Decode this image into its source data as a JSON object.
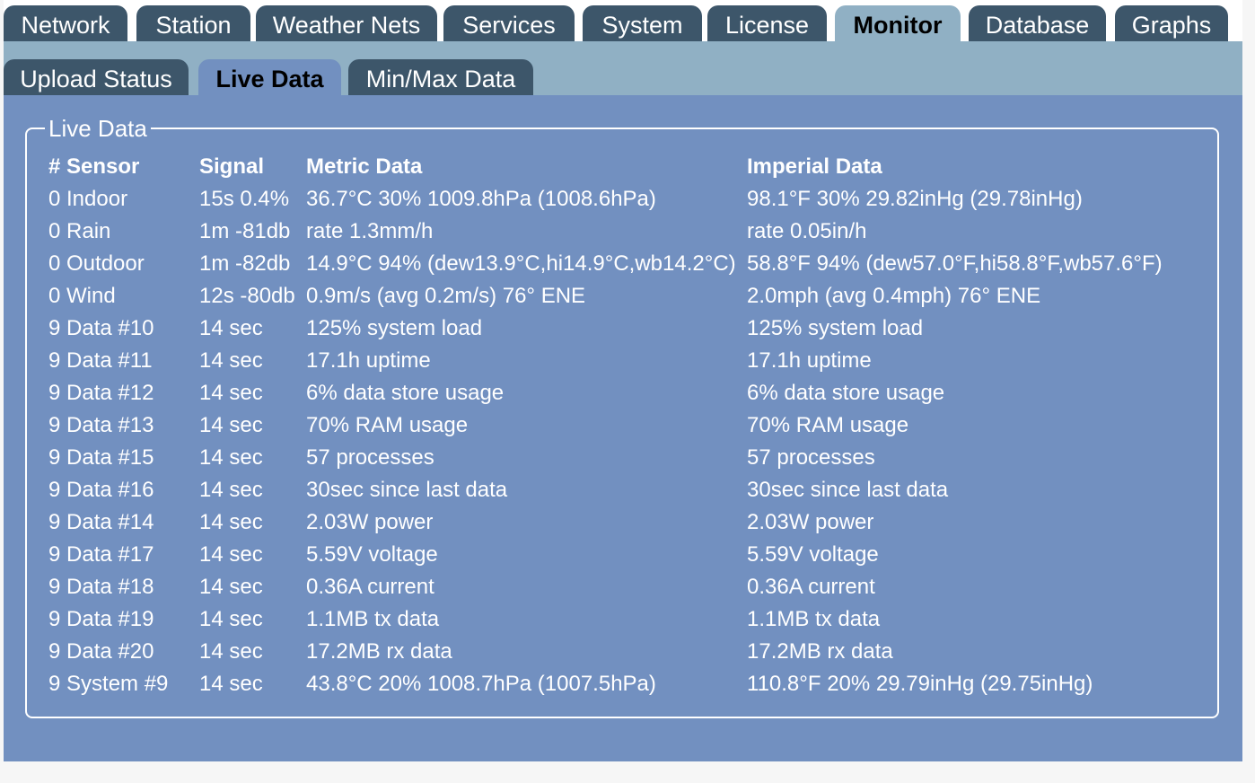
{
  "top_tabs": [
    "Network",
    "Station",
    "Weather Nets",
    "Services",
    "System",
    "License",
    "Monitor",
    "Database",
    "Graphs"
  ],
  "sub_tabs": [
    "Upload Status",
    "Live Data",
    "Min/Max Data"
  ],
  "live_data": {
    "legend": "Live Data",
    "headers": [
      "# Sensor",
      "Signal",
      "Metric Data",
      "Imperial Data"
    ],
    "rows": [
      [
        "0 Indoor",
        "15s 0.4%",
        "36.7°C 30% 1009.8hPa (1008.6hPa)",
        "98.1°F 30% 29.82inHg (29.78inHg)"
      ],
      [
        "0 Rain",
        "1m -81db",
        "rate 1.3mm/h",
        "rate 0.05in/h"
      ],
      [
        "0 Outdoor",
        "1m -82db",
        "14.9°C 94% (dew13.9°C,hi14.9°C,wb14.2°C)",
        "58.8°F 94% (dew57.0°F,hi58.8°F,wb57.6°F)"
      ],
      [
        "0 Wind",
        "12s -80db",
        "0.9m/s (avg 0.2m/s) 76° ENE",
        "2.0mph (avg 0.4mph) 76° ENE"
      ],
      [
        "9 Data #10",
        "14 sec",
        "125% system load",
        "125% system load"
      ],
      [
        "9 Data #11",
        "14 sec",
        "17.1h uptime",
        "17.1h uptime"
      ],
      [
        "9 Data #12",
        "14 sec",
        "6% data store usage",
        "6% data store usage"
      ],
      [
        "9 Data #13",
        "14 sec",
        "70% RAM usage",
        "70% RAM usage"
      ],
      [
        "9 Data #15",
        "14 sec",
        "57 processes",
        "57 processes"
      ],
      [
        "9 Data #16",
        "14 sec",
        "30sec since last data",
        "30sec since last data"
      ],
      [
        "9 Data #14",
        "14 sec",
        "2.03W power",
        "2.03W power"
      ],
      [
        "9 Data #17",
        "14 sec",
        "5.59V voltage",
        "5.59V voltage"
      ],
      [
        "9 Data #18",
        "14 sec",
        "0.36A current",
        "0.36A current"
      ],
      [
        "9 Data #19",
        "14 sec",
        "1.1MB tx data",
        "1.1MB tx data"
      ],
      [
        "9 Data #20",
        "14 sec",
        "17.2MB rx data",
        "17.2MB rx data"
      ],
      [
        "9 System #9",
        "14 sec",
        "43.8°C 20% 1008.7hPa (1007.5hPa)",
        "110.8°F 20% 29.79inHg (29.75inHg)"
      ]
    ]
  }
}
